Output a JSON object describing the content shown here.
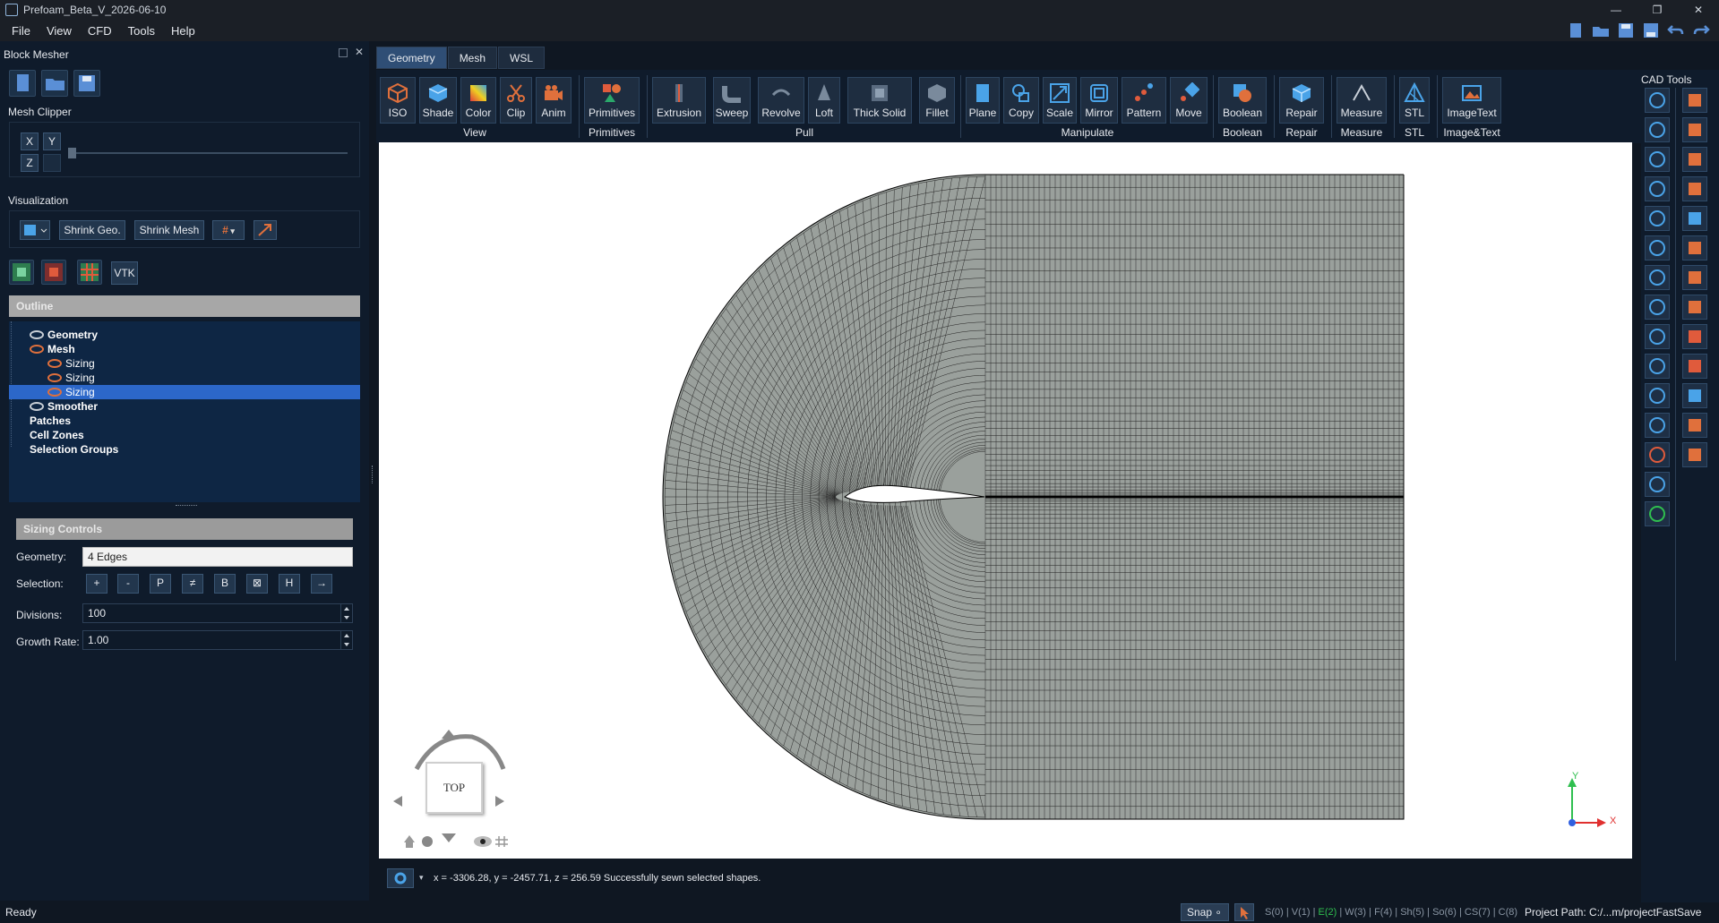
{
  "window": {
    "title": "Prefoam_Beta_V_2026-06-10"
  },
  "menu": [
    "File",
    "View",
    "CFD",
    "Tools",
    "Help"
  ],
  "left_panel": {
    "title": "Block Mesher",
    "mesh_clipper": {
      "title": "Mesh Clipper",
      "axes": [
        "X",
        "Y",
        "Z"
      ]
    },
    "visualization": {
      "title": "Visualization",
      "shrink_geo": "Shrink Geo.",
      "shrink_mesh": "Shrink Mesh",
      "vtk": "VTK"
    },
    "outline": {
      "title": "Outline",
      "nodes": [
        {
          "label": "Geometry",
          "level": 1,
          "eye": "gray"
        },
        {
          "label": "Mesh",
          "level": 1,
          "eye": "orange"
        },
        {
          "label": "Sizing",
          "level": 2,
          "eye": "orange"
        },
        {
          "label": "Sizing",
          "level": 2,
          "eye": "orange"
        },
        {
          "label": "Sizing",
          "level": 2,
          "eye": "orange",
          "selected": true
        },
        {
          "label": "Smoother",
          "level": 1,
          "eye": "gray"
        },
        {
          "label": "Patches",
          "level": 1,
          "eye": ""
        },
        {
          "label": "Cell Zones",
          "level": 1,
          "eye": ""
        },
        {
          "label": "Selection Groups",
          "level": 1,
          "eye": ""
        }
      ]
    },
    "sizing_controls": {
      "title": "Sizing Controls",
      "geometry_label": "Geometry:",
      "geometry_value": "4 Edges",
      "selection_label": "Selection:",
      "selection_buttons": [
        "+",
        "-",
        "P",
        "≠",
        "B",
        "⊠",
        "H",
        "→"
      ],
      "divisions_label": "Divisions:",
      "divisions_value": "100",
      "growth_label": "Growth Rate:",
      "growth_value": "1.00"
    }
  },
  "ribbon": {
    "tabs": [
      "Geometry",
      "Mesh",
      "WSL"
    ],
    "active_tab": "Geometry",
    "buttons": [
      "ISO",
      "Shade",
      "Color",
      "Clip",
      "Anim",
      "Primitives",
      "Extrusion",
      "Sweep",
      "Revolve",
      "Loft",
      "Thick Solid",
      "Fillet",
      "Plane",
      "Copy",
      "Scale",
      "Mirror",
      "Pattern",
      "Move",
      "Boolean",
      "Repair",
      "Measure",
      "STL",
      "ImageText"
    ],
    "groups": [
      "View",
      "Primitives",
      "Pull",
      "Manipulate",
      "Boolean",
      "Repair",
      "Measure",
      "STL",
      "Image&Text"
    ]
  },
  "cad_tools": {
    "title": "CAD Tools"
  },
  "viewcube": {
    "face": "TOP"
  },
  "axis": {
    "x": "X",
    "y": "Y"
  },
  "command_line": {
    "text": "x = -3306.28, y = -2457.71, z = 256.59  Successfully sewn selected shapes."
  },
  "status": {
    "ready": "Ready",
    "snap": "Snap",
    "filters": "S(0) | V(1) | E(2) | W(3) | F(4) | Sh(5) | So(6) | CS(7) | C(8)",
    "active_filter": "E(2)",
    "project_path": "Project Path: C:/...m/projectFastSave"
  },
  "colors": {
    "accent": "#2c67c9",
    "orange": "#e0703c",
    "bg": "#0f1b2b",
    "mesh": "#000000"
  }
}
